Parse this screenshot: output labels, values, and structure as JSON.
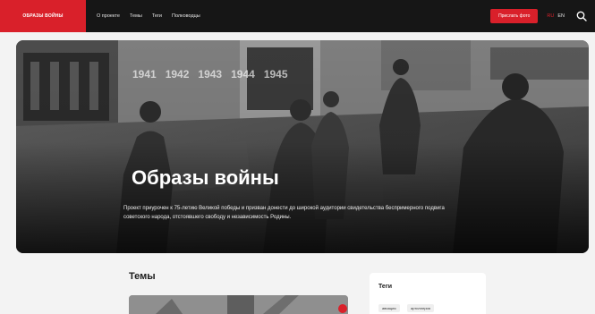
{
  "header": {
    "logo": "ОБРАЗЫ ВОЙНЫ",
    "nav": [
      "О проекте",
      "Темы",
      "Теги",
      "Полководцы"
    ],
    "cta": "Прислать фото",
    "lang_active": "RU",
    "lang_other": "EN"
  },
  "hero": {
    "years": [
      "1941",
      "1942",
      "1943",
      "1944",
      "1945"
    ],
    "title": "Образы войны",
    "description": "Проект приурочен к 75-летию Великой победы и призван донести до широкой аудитории свидетельства беспримерного подвига советского народа, отстоявшего свободу и независимость Родины."
  },
  "sections": {
    "themes_title": "Темы",
    "tags_title": "Теги",
    "tags": [
      "авиация",
      "артиллерия"
    ]
  },
  "colors": {
    "accent": "#d9202a",
    "header_bg": "#161616"
  }
}
